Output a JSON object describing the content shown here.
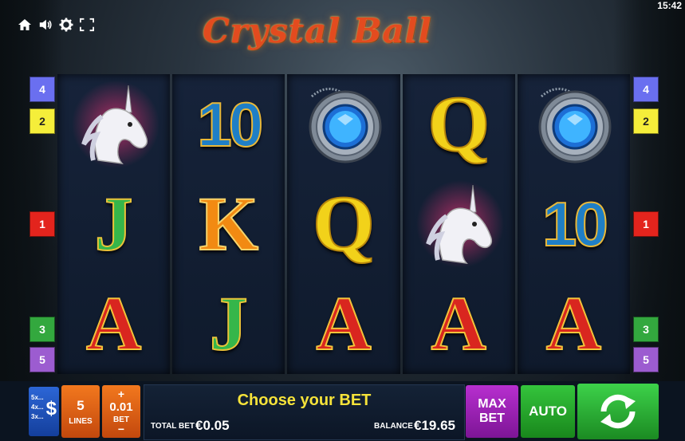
{
  "status_bar": {
    "time": "15:42"
  },
  "toolbar": {
    "icons": [
      "home-icon",
      "volume-icon",
      "gear-icon",
      "fullscreen-icon"
    ]
  },
  "title": "Crystal Ball",
  "reels": [
    [
      "unicorn",
      "J",
      "A"
    ],
    [
      "10",
      "K",
      "J"
    ],
    [
      "crystal-amulet",
      "Q",
      "A"
    ],
    [
      "Q",
      "unicorn",
      "A"
    ],
    [
      "crystal-amulet",
      "10",
      "A"
    ]
  ],
  "paylines": [
    {
      "label": "4",
      "color": "#6a6ff0"
    },
    {
      "label": "2",
      "color": "#f5ee3a"
    },
    {
      "label": "1",
      "color": "#e3241d"
    },
    {
      "label": "3",
      "color": "#33a83e"
    },
    {
      "label": "5",
      "color": "#9c5cd0"
    }
  ],
  "controls": {
    "paytable": {
      "rows": [
        "5x...",
        "4x...",
        "3x..."
      ],
      "symbol": "$"
    },
    "lines": {
      "value": "5",
      "label": "LINES"
    },
    "bet": {
      "plus": "+",
      "value": "0.01",
      "label": "BET",
      "minus": "−"
    },
    "message": "Choose your BET",
    "total_bet": {
      "label": "TOTAL BET",
      "value": "€0.05"
    },
    "balance": {
      "label": "BALANCE",
      "value": "€19.65"
    },
    "max_bet": {
      "line1": "MAX",
      "line2": "BET"
    },
    "auto": "AUTO"
  }
}
